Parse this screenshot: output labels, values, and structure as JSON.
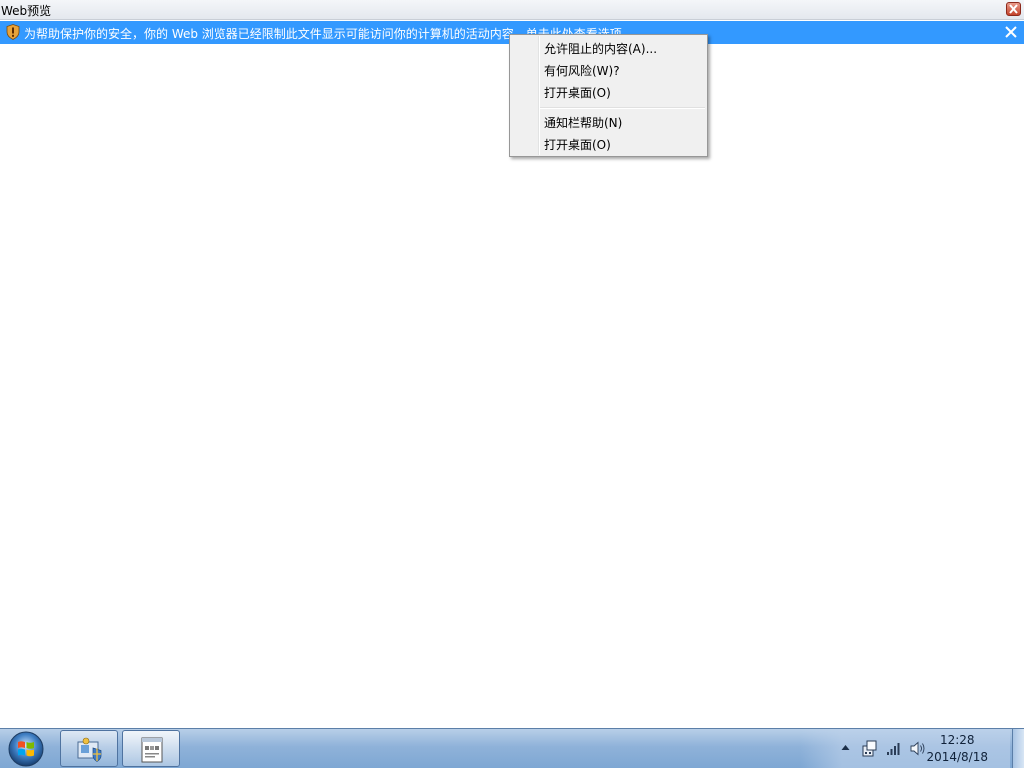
{
  "window": {
    "title": "Web预览"
  },
  "infobar": {
    "message": "为帮助保护你的安全，你的 Web 浏览器已经限制此文件显示可能访问你的计算机的活动内容。单击此处查看选项..."
  },
  "context_menu": {
    "items": [
      {
        "label": "允许阻止的内容(A)..."
      },
      {
        "label": "有何风险(W)?"
      },
      {
        "label": "打开桌面(O)"
      },
      {
        "label": "通知栏帮助(N)"
      },
      {
        "label": "打开桌面(O)"
      }
    ]
  },
  "taskbar": {
    "clock": {
      "time": "12:28",
      "date": "2014/8/18"
    }
  },
  "colors": {
    "infobar": "#3399ff",
    "taskbar": "#8fb2d9"
  },
  "icons": [
    "shield-warning-icon",
    "close-icon",
    "windows-start-icon",
    "control-panel-icon",
    "document-icon",
    "arrow-up-icon",
    "network-icon",
    "signal-icon",
    "speaker-icon"
  ]
}
